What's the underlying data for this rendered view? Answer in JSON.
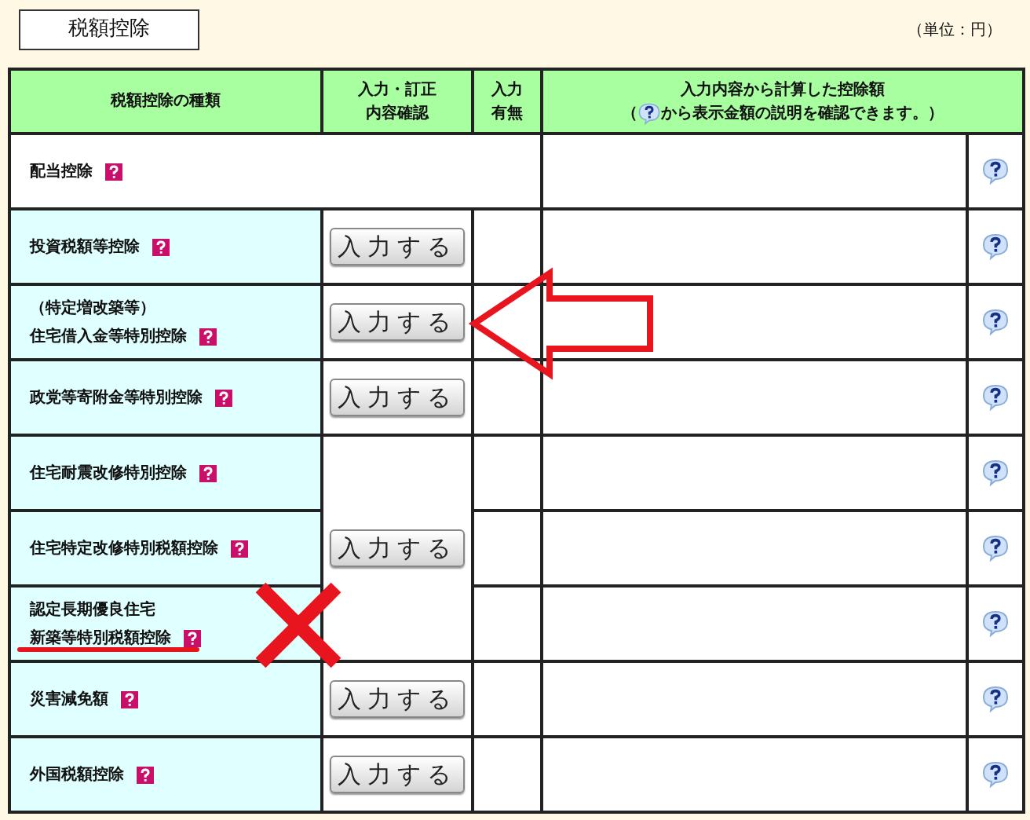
{
  "title": "税額控除",
  "unit": "（単位：円）",
  "columns": [
    {
      "lines": [
        "税額控除の種類"
      ]
    },
    {
      "lines": [
        "入力・訂正",
        "内容確認"
      ]
    },
    {
      "lines": [
        "入力",
        "有無"
      ]
    },
    {
      "lines": [
        "入力内容から計算した控除額"
      ],
      "note_before": "（",
      "note_after": "から表示金額の説明を確認できます。）"
    }
  ],
  "rows": [
    {
      "kind": "wide",
      "lines": [
        "配当控除"
      ]
    },
    {
      "kind": "button",
      "lines": [
        "投資税額等控除"
      ],
      "button": "入力する"
    },
    {
      "kind": "button",
      "lines": [
        "（特定増改築等）",
        "住宅借入金等特別控除"
      ],
      "button": "入力する"
    },
    {
      "kind": "button",
      "lines": [
        "政党等寄附金等特別控除"
      ],
      "button": "入力する"
    },
    {
      "kind": "group",
      "button": "入力する",
      "rows": [
        {
          "lines": [
            "住宅耐震改修特別控除"
          ]
        },
        {
          "lines": [
            "住宅特定改修特別税額控除"
          ]
        },
        {
          "lines": [
            "認定長期優良住宅",
            "新築等特別税額控除"
          ]
        }
      ]
    },
    {
      "kind": "button",
      "lines": [
        "災害減免額"
      ],
      "button": "入力する"
    },
    {
      "kind": "button",
      "lines": [
        "外国税額控除"
      ],
      "button": "入力する"
    }
  ]
}
